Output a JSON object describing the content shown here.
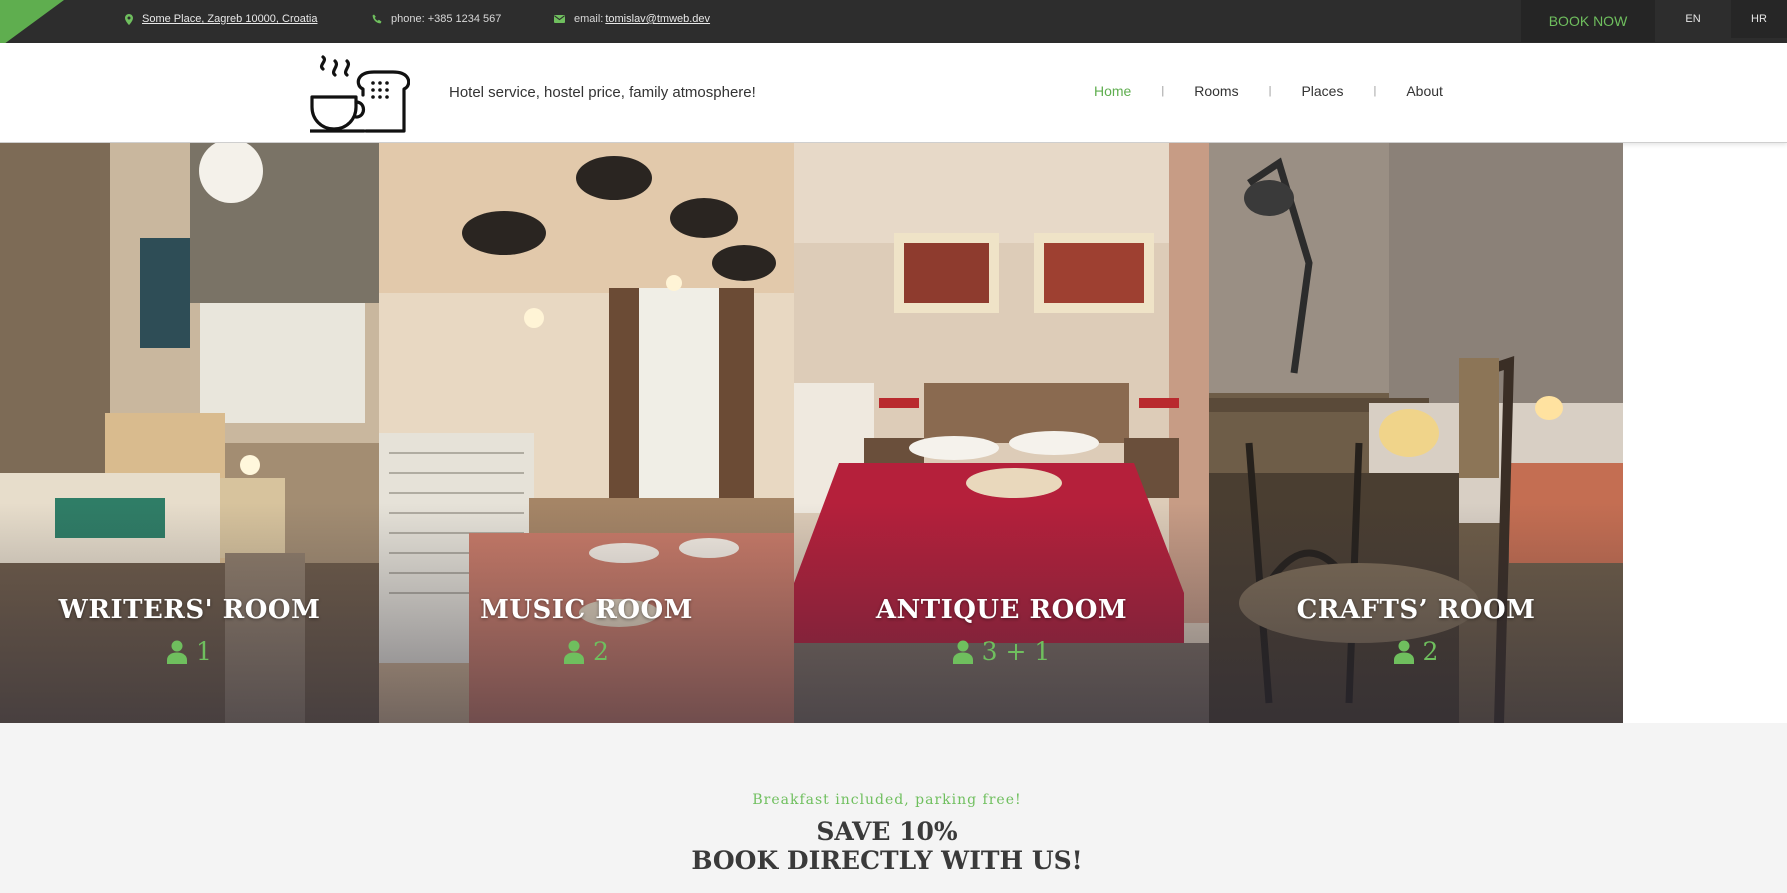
{
  "topbar": {
    "address": "Some Place, Zagreb 10000, Croatia",
    "phone": "phone: +385 1234 567",
    "email_prefix": "email: ",
    "email": "tomislav@tmweb.dev",
    "book_now": "BOOK NOW",
    "languages": [
      "EN",
      "HR"
    ],
    "accent_color": "#6fbf5e"
  },
  "header": {
    "tagline": "Hotel service, hostel price, family atmosphere!",
    "nav": [
      {
        "label": "Home",
        "active": true
      },
      {
        "label": "Rooms",
        "active": false
      },
      {
        "label": "Places",
        "active": false
      },
      {
        "label": "About",
        "active": false
      }
    ],
    "nav_separator": "|"
  },
  "rooms": [
    {
      "name": "WRITERS' ROOM",
      "capacity": "1"
    },
    {
      "name": "MUSIC ROOM",
      "capacity": "2"
    },
    {
      "name": "ANTIQUE ROOM",
      "capacity": "3 + 1"
    },
    {
      "name": "CRAFTS’ ROOM",
      "capacity": "2"
    }
  ],
  "promo": {
    "subtitle": "Breakfast included, parking free!",
    "title_line1": "SAVE 10%",
    "title_line2": "BOOK DIRECTLY WITH US!"
  }
}
